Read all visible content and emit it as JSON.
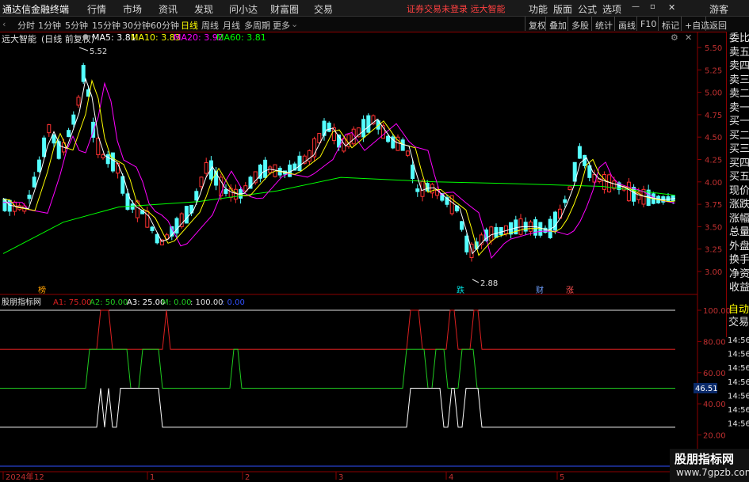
{
  "menubar": {
    "app_title": "通达信金融终端",
    "items": [
      "行情",
      "市场",
      "资讯",
      "发现",
      "问小达",
      "财富圈",
      "交易"
    ],
    "notice": "证券交易未登录  远大智能",
    "right_items": [
      "功能",
      "版面",
      "公式",
      "选项"
    ],
    "user": "游客"
  },
  "tabbar": {
    "tabs": [
      "分时",
      "1分钟",
      "5分钟",
      "15分钟",
      "30分钟",
      "60分钟",
      "日线",
      "周线",
      "月线",
      "多周期",
      "更多"
    ],
    "active": "日线",
    "right_tabs": [
      "复权",
      "叠加",
      "多股",
      "统计",
      "画线",
      "F10",
      "标记",
      "+自选",
      "返回"
    ]
  },
  "chart_header": {
    "stock": "远大智能",
    "period_note": "(日线 前复权)",
    "ma": [
      {
        "label": "MA5: 3.81",
        "color": "#ffffff"
      },
      {
        "label": "MA10: 3.83",
        "color": "#ffff00"
      },
      {
        "label": "MA20: 3.92",
        "color": "#ff00ff"
      },
      {
        "label": "MA60: 3.81",
        "color": "#00ff00"
      }
    ]
  },
  "sidebar": [
    "委比",
    "卖五",
    "卖四",
    "卖三",
    "卖二",
    "卖一",
    "买一",
    "买二",
    "买三",
    "买四",
    "买五",
    "现价",
    "涨跌",
    "涨幅",
    "总量",
    "外盘",
    "换手",
    "净资",
    "收益"
  ],
  "sidebar_lower": [
    "自动",
    "交易"
  ],
  "sub_time_labels": [
    "14:56",
    "14:56",
    "14:56",
    "14:56",
    "14:56",
    "14:56",
    "14:56"
  ],
  "price_axis": [
    "5.50",
    "5.25",
    "5.00",
    "4.75",
    "4.50",
    "4.25",
    "4.00",
    "3.75",
    "3.50",
    "3.25",
    "3.00"
  ],
  "annotations": {
    "high": "5.52",
    "low": "2.88",
    "mark_1": "榜",
    "mark_2": "跌",
    "mark_3": "财",
    "mark_4": "涨"
  },
  "indicator": {
    "name": "股朋指标网",
    "a1": "A1: 75.00",
    "a2": "A2: 50.00",
    "a3": "A3: 25.00",
    "m": "M: 0.00",
    "c100": ": 100.00",
    "c0": ": 0.00",
    "axis": [
      "100.00",
      "80.00",
      "60.00",
      "40.00",
      "20.00"
    ],
    "current": "46.51"
  },
  "date_axis": [
    "2024年",
    "12",
    "1",
    "2",
    "3",
    "4",
    "5"
  ],
  "watermark": {
    "name": "股朋指标网",
    "url": "www.7gpzb.com"
  },
  "colors": {
    "up": "#ff3232",
    "down": "#54ffff",
    "ma5": "#ffffff",
    "ma10": "#ffff00",
    "ma20": "#ff00ff",
    "ma60": "#00ff00",
    "a1": "#dd2020",
    "a2": "#20cc20",
    "a3": "#ffffff"
  }
}
